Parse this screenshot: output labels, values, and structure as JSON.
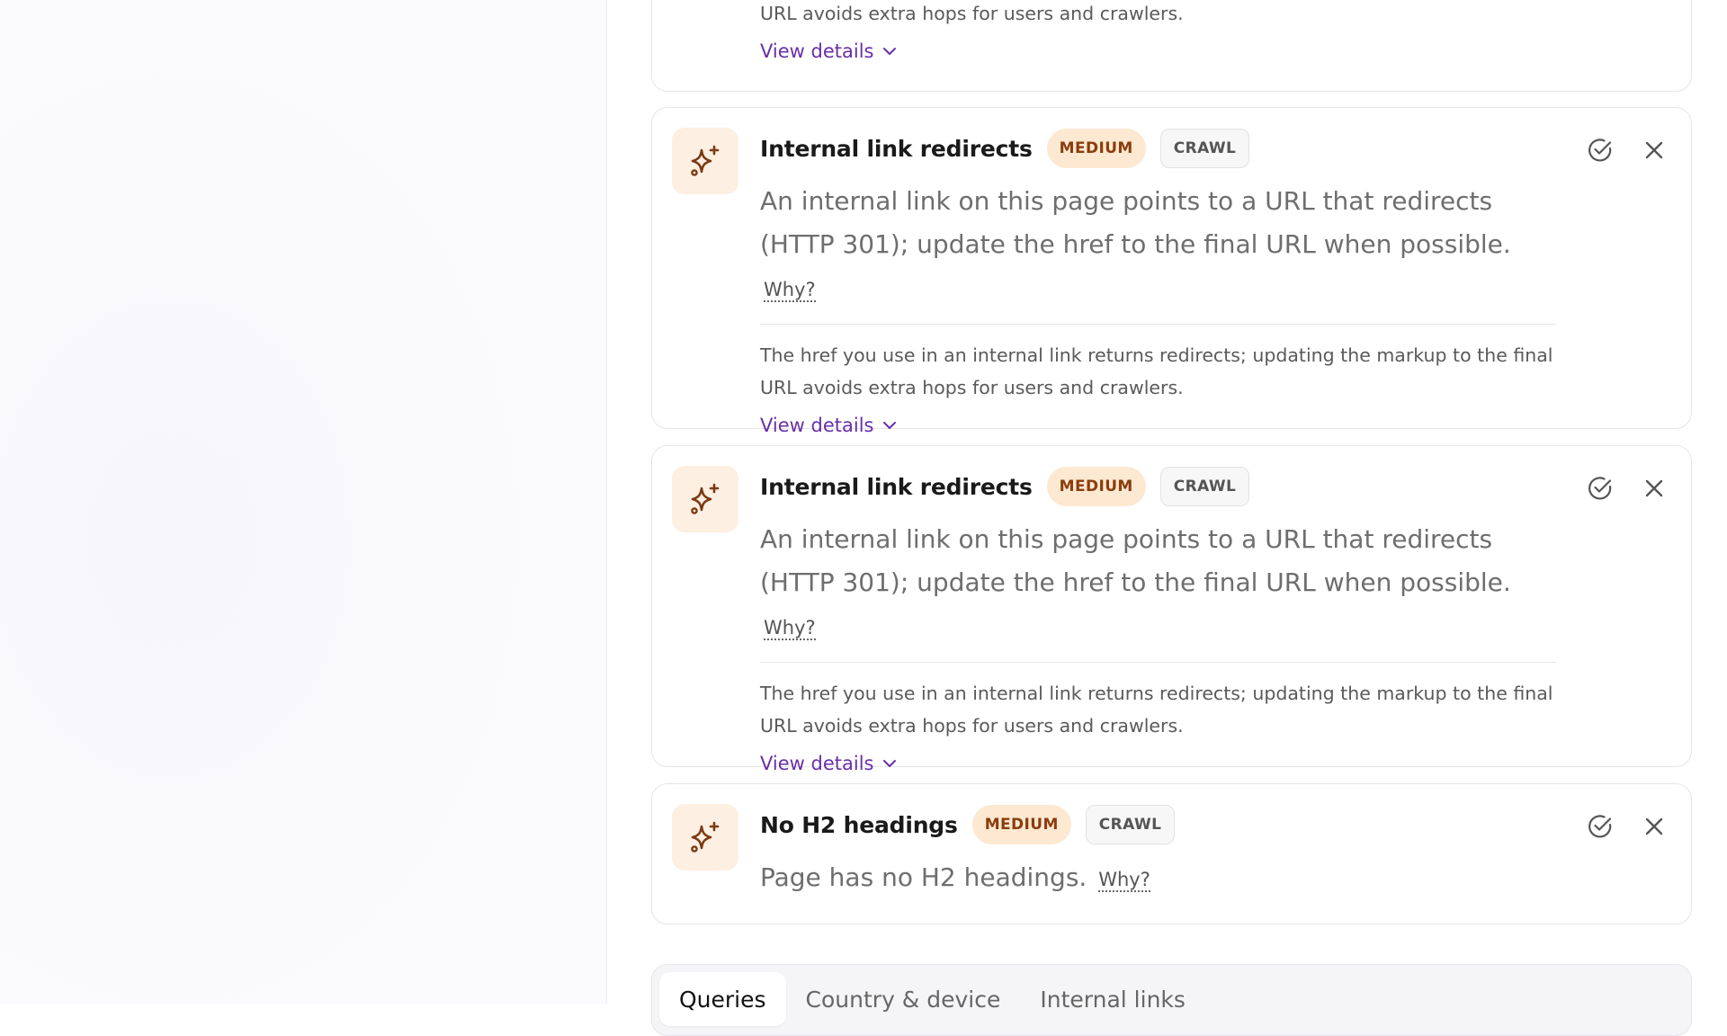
{
  "colors": {
    "accent_link": "#6a2fa8",
    "badge_medium_bg": "#fde8d2",
    "badge_medium_text": "#8a3d0c",
    "icon_tile_bg": "#fdefe2",
    "icon_color": "#7a3a12"
  },
  "top_partial_card": {
    "explain_line": "URL avoids extra hops for users and crawlers.",
    "view_details": "View details"
  },
  "issues": [
    {
      "icon": "sparkles-icon",
      "title": "Internal link redirects",
      "severity": "MEDIUM",
      "category": "CRAWL",
      "summary": "An internal link on this page points to a URL that redirects (HTTP 301); update the href to the final URL when possible.",
      "why": "Why?",
      "explain": "The href you use in an internal link returns redirects; updating the markup to the final URL avoids extra hops for users and crawlers.",
      "view_details": "View details"
    },
    {
      "icon": "sparkles-icon",
      "title": "Internal link redirects",
      "severity": "MEDIUM",
      "category": "CRAWL",
      "summary": "An internal link on this page points to a URL that redirects (HTTP 301); update the href to the final URL when possible.",
      "why": "Why?",
      "explain": "The href you use in an internal link returns redirects; updating the markup to the final URL avoids extra hops for users and crawlers.",
      "view_details": "View details"
    },
    {
      "icon": "sparkles-icon",
      "title": "No H2 headings",
      "severity": "MEDIUM",
      "category": "CRAWL",
      "summary": "Page has no H2 headings.",
      "why": "Why?"
    }
  ],
  "tabs": [
    {
      "label": "Queries",
      "active": true
    },
    {
      "label": "Country & device",
      "active": false
    },
    {
      "label": "Internal links",
      "active": false
    }
  ]
}
